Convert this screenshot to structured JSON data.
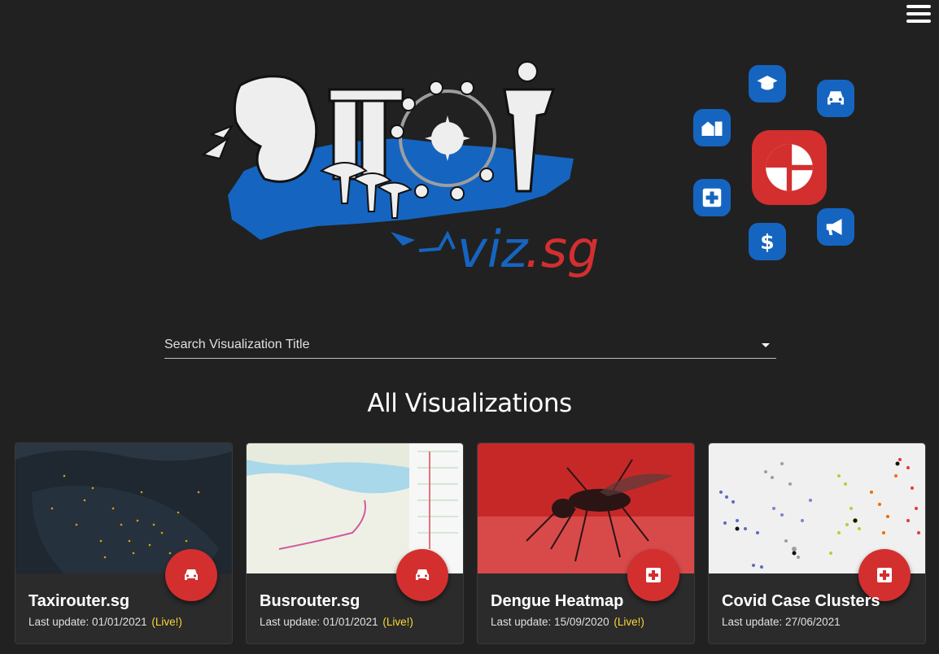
{
  "logo": {
    "suffix_text": "viz",
    "domain_text": ".sg"
  },
  "search": {
    "placeholder": "Search Visualization Title"
  },
  "section_title": "All Visualizations",
  "icons": [
    "graduation-cap-icon",
    "car-icon",
    "building-icon",
    "hospital-cross-icon",
    "dollar-icon",
    "megaphone-icon",
    "logo-mark-icon"
  ],
  "colors": {
    "brand_blue": "#1565c0",
    "brand_red": "#d32f2f",
    "live_yellow": "#fdd835",
    "background": "#212121"
  },
  "cards": [
    {
      "title": "Taxirouter.sg",
      "last_update_label": "Last update: 01/01/2021",
      "live_label": "(Live!)",
      "icon": "car-icon"
    },
    {
      "title": "Busrouter.sg",
      "last_update_label": "Last update: 01/01/2021",
      "live_label": "(Live!)",
      "icon": "car-icon"
    },
    {
      "title": "Dengue Heatmap",
      "last_update_label": "Last update: 15/09/2020",
      "live_label": "(Live!)",
      "icon": "medical-cross-icon"
    },
    {
      "title": "Covid Case Clusters",
      "last_update_label": "Last update: 27/06/2021",
      "live_label": "",
      "icon": "medical-cross-icon"
    }
  ]
}
